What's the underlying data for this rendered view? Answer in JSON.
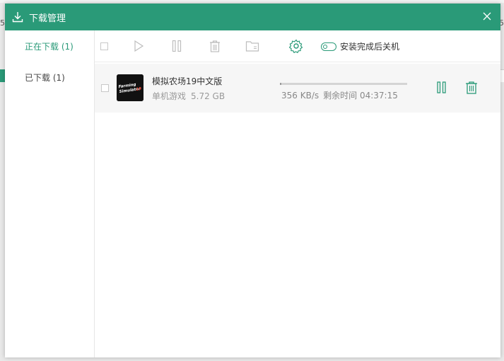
{
  "background": {
    "left_char": "5",
    "right_char": "5"
  },
  "window": {
    "title": "下载管理",
    "accent_color": "#2a9a78"
  },
  "sidebar": {
    "items": [
      {
        "label": "正在下载 (1)",
        "active": true
      },
      {
        "label": "已下载 (1)",
        "active": false
      }
    ]
  },
  "toolbar": {
    "icons": [
      "select-all-checkbox",
      "play-icon",
      "pause-icon",
      "delete-icon",
      "folder-icon",
      "gear-icon"
    ],
    "shutdown_toggle_label": "安装完成后关机"
  },
  "downloads": [
    {
      "name": "模拟农场19中文版",
      "category": "单机游戏",
      "size": "5.72 GB",
      "icon_text": "Farming Simulator 19",
      "progress": 0.01,
      "speed": "356 KB/s",
      "remaining": "剩余时间 04:37:15"
    }
  ]
}
